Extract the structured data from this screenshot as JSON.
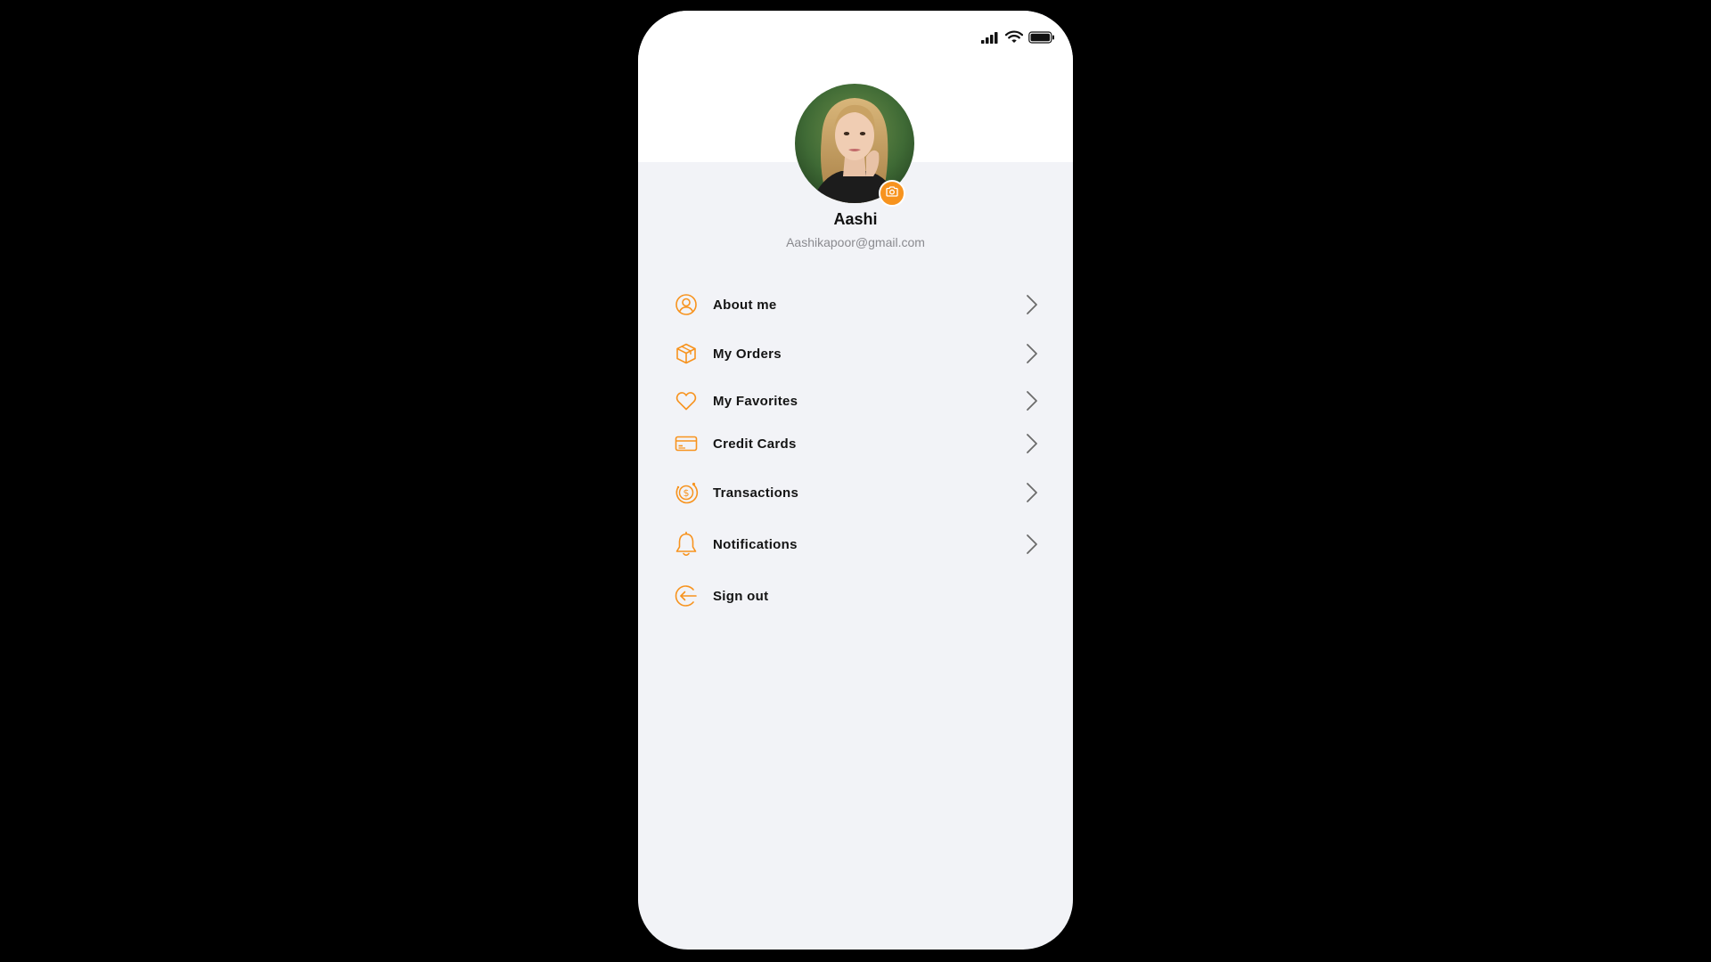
{
  "profile": {
    "name": "Aashi",
    "email": "Aashikapoor@gmail.com"
  },
  "icons": {
    "signal": "cellular-signal-icon",
    "wifi": "wifi-icon",
    "battery": "battery-icon",
    "camera": "camera-icon",
    "chevron": "chevron-right-icon"
  },
  "colors": {
    "accent": "#f7931e",
    "background": "#f2f3f7",
    "header": "#ffffff",
    "text": "#141414",
    "muted": "#8a8a8f"
  },
  "menu": {
    "items": [
      {
        "label": "About me",
        "icon": "user-icon"
      },
      {
        "label": "My Orders",
        "icon": "box-icon"
      },
      {
        "label": "My Favorites",
        "icon": "heart-icon"
      },
      {
        "label": "Credit Cards",
        "icon": "credit-card-icon"
      },
      {
        "label": "Transactions",
        "icon": "dollar-coin-icon"
      },
      {
        "label": "Notifications",
        "icon": "bell-icon"
      },
      {
        "label": "Sign out",
        "icon": "sign-out-icon"
      }
    ]
  }
}
